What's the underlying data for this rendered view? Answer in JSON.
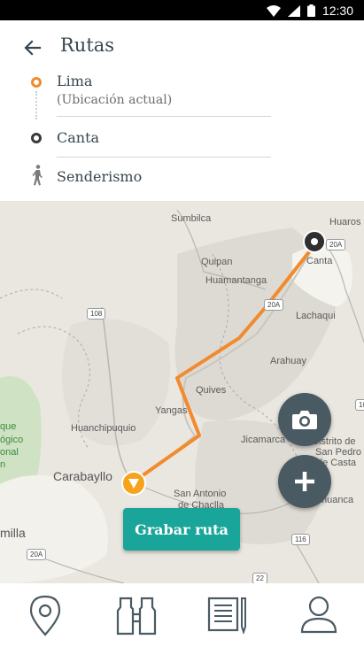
{
  "status_bar": {
    "time": "12:30"
  },
  "header": {
    "title": "Rutas",
    "origin": {
      "name": "Lima",
      "subtitle": "(Ubicación actual)"
    },
    "destination": {
      "name": "Canta"
    },
    "mode": {
      "name": "Senderismo"
    }
  },
  "map": {
    "labels": {
      "huaros": "Huaros",
      "sumbilca": "Sumbilca",
      "quipan": "Quipan",
      "huamantanga": "Huamantanga",
      "canta": "Canta",
      "lachaqui": "Lachaqui",
      "arahuay": "Arahuay",
      "quives": "Quives",
      "yangas": "Yangas",
      "huanchipuquio": "Huanchipuquio",
      "jicamarca": "Jicamarca",
      "distrito": "Distrito de",
      "san_pedro": "San Pedro",
      "de_casta": "de Casta",
      "huanca": "huanca",
      "carabayllo": "Carabayllo",
      "san_antonio": "San Antonio",
      "de_chaclla": "de Chaclla",
      "milla": "milla",
      "que": "que",
      "logico": "ógico",
      "onal": "onal",
      "n": "n"
    },
    "shields": {
      "r108": "108",
      "r20a_top": "20A",
      "r20a_mid": "20A",
      "r10": "10",
      "r116": "116",
      "r20a_bottom": "20A",
      "r22": "22"
    },
    "record_button_label": "Grabar ruta"
  },
  "colors": {
    "route": "#f28a2e",
    "accent": "#1aa59a",
    "fab": "#4a5a63",
    "origin": "#f28a2e"
  },
  "icons": {
    "back": "arrow-left-icon",
    "walk": "hiker-icon",
    "camera": "camera-icon",
    "add": "plus-icon",
    "nav": [
      "location-pin-icon",
      "binoculars-icon",
      "journal-icon",
      "person-icon"
    ]
  }
}
